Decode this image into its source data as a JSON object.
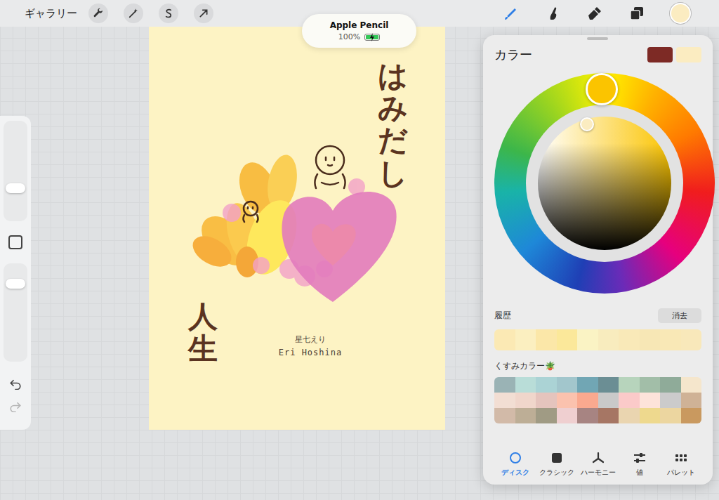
{
  "toolbar": {
    "gallery": "ギャラリー",
    "tools": [
      {
        "kind": "brush",
        "selected": true
      },
      {
        "kind": "smudge",
        "selected": false
      },
      {
        "kind": "eraser",
        "selected": false
      },
      {
        "kind": "layers",
        "selected": false
      }
    ],
    "current_color": "#fbecc1"
  },
  "toast": {
    "title": "Apple Pencil",
    "battery": "100%",
    "level": 1
  },
  "canvas": {
    "title": "はみだし",
    "subtitle": "人生",
    "author_ja": "星七えり",
    "author_en": "Eri Hoshina"
  },
  "sidebar": {
    "brush_size": {
      "level": 0.33
    },
    "opacity": {
      "level": 0.79
    },
    "redo_disabled": true
  },
  "color_panel": {
    "title": "カラー",
    "primary": "#7d2a25",
    "secondary": "#fbecc1",
    "wheel": {
      "hue": 0.995,
      "hue_color": "#fbc400",
      "saturation": 0.37,
      "brightness": 0.94,
      "picked_color": "#fbecc1"
    },
    "history_label": "履歴",
    "clear": "消去",
    "history": [
      {
        "color": "#fbe9b4"
      },
      {
        "color": "#fbefc0"
      },
      {
        "color": "#fbe7a8"
      },
      {
        "color": "#fbe89a"
      },
      {
        "color": "#faf3c4"
      },
      {
        "color": "#f8ecbe"
      },
      {
        "color": "#f9e9b8"
      },
      {
        "color": "#f7e7b5"
      },
      {
        "color": "#f9e8b6"
      },
      {
        "color": "#f8e8ba"
      }
    ],
    "palette_name": "くすみカラー🪴",
    "palette": [
      {
        "color": "#9ab3b5"
      },
      {
        "color": "#b9ddd8"
      },
      {
        "color": "#abd3d5"
      },
      {
        "color": "#a2c6cc"
      },
      {
        "color": "#71a6b4"
      },
      {
        "color": "#6b8e94"
      },
      {
        "color": "#b7d4bc"
      },
      {
        "color": "#a2bea8"
      },
      {
        "color": "#8fab99"
      },
      {
        "color": "#f5e6cc"
      },
      {
        "color": "#f2ded3"
      },
      {
        "color": "#f0d6cb"
      },
      {
        "color": "#e5c4bd"
      },
      {
        "color": "#fbc2ae"
      },
      {
        "color": "#faa98f"
      },
      {
        "color": "#c9c9c9"
      },
      {
        "color": "#fbcac9"
      },
      {
        "color": "#fde3da"
      },
      {
        "color": "#cbcbcb"
      },
      {
        "color": "#cfb296"
      },
      {
        "color": "#d2baa8"
      },
      {
        "color": "#bdae96"
      },
      {
        "color": "#a09b84"
      },
      {
        "color": "#efcfd0"
      },
      {
        "color": "#a78482"
      },
      {
        "color": "#a67664"
      },
      {
        "color": "#ead5b0"
      },
      {
        "color": "#eed98e"
      },
      {
        "color": "#ecd6a0"
      },
      {
        "color": "#c9995f"
      }
    ],
    "tabs": [
      {
        "label": "ディスク",
        "kind": "disc",
        "selected": true
      },
      {
        "label": "クラシック",
        "kind": "classic",
        "selected": false
      },
      {
        "label": "ハーモニー",
        "kind": "harmony",
        "selected": false
      },
      {
        "label": "値",
        "kind": "value",
        "selected": false
      },
      {
        "label": "パレット",
        "kind": "palette",
        "selected": false
      }
    ]
  }
}
